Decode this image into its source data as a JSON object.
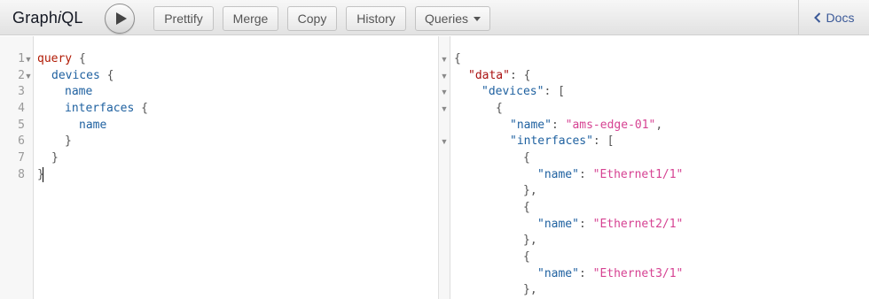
{
  "header": {
    "title_prefix": "Graph",
    "title_italic": "i",
    "title_suffix": "QL",
    "buttons": {
      "prettify": "Prettify",
      "merge": "Merge",
      "copy": "Copy",
      "history": "History",
      "queries": "Queries"
    },
    "docs_label": "Docs"
  },
  "query_editor": {
    "line_numbers": [
      "1",
      "2",
      "3",
      "4",
      "5",
      "6",
      "7",
      "8"
    ],
    "lines": {
      "l1_kw": "query",
      "l1_brace": " {",
      "l2_field": "devices",
      "l2_brace": " {",
      "l3_field": "name",
      "l4_field": "interfaces",
      "l4_brace": " {",
      "l5_field": "name",
      "l6_brace": "}",
      "l7_brace": "}",
      "l8_brace": "}"
    }
  },
  "result_viewer": {
    "open_brace": "{",
    "data_key": "\"data\"",
    "devices_key": "\"devices\"",
    "name_key": "\"name\"",
    "interfaces_key": "\"interfaces\"",
    "device_name": "\"ams-edge-01\"",
    "interface_names": [
      "\"Ethernet1/1\"",
      "\"Ethernet2/1\"",
      "\"Ethernet3/1\""
    ]
  }
}
